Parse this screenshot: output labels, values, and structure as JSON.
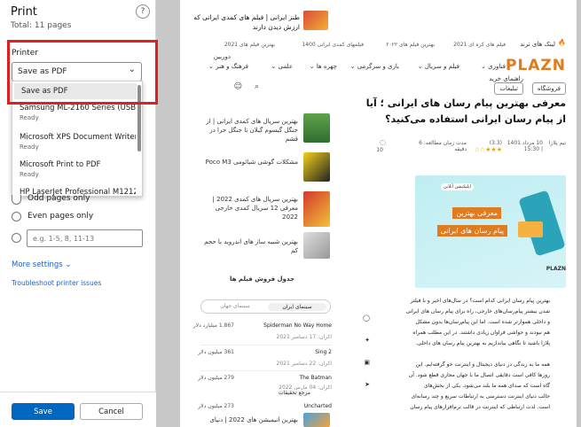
{
  "dialog": {
    "title": "Print",
    "total": "Total: 11 pages",
    "help": "?",
    "printer_label": "Printer",
    "selected_printer": "Save as PDF",
    "printers": [
      {
        "name": "Save as PDF",
        "status": ""
      },
      {
        "name": "Samsung ML-2160 Series (USB001)",
        "status": "Ready"
      },
      {
        "name": "Microsoft XPS Document Writer",
        "status": "Ready"
      },
      {
        "name": "Microsoft Print to PDF",
        "status": "Ready"
      },
      {
        "name": "HP LaserJet Professional M1212nf M",
        "status": ""
      }
    ],
    "odd_only": "Odd pages only",
    "even_only": "Even pages only",
    "range_placeholder": "e.g. 1-5, 8, 11-13",
    "more_settings": "More settings ⌄",
    "troubleshoot": "Troubleshoot printer issues",
    "save": "Save",
    "cancel": "Cancel"
  },
  "preview": {
    "promo": "طنز ایرانی | فیلم های کمدی ایرانی که ارزش دیدن دارند",
    "trend_label": "لینک های ترند",
    "trends": [
      "فیلم های کره ای 2021",
      "بهترین فیلم های ۲۰۲۲",
      "فیلمهای کمدی ایرانی 1400",
      "بهترین فیلم های 2021"
    ],
    "logo": "PLAZN",
    "nav": [
      "فناوری ⌄",
      "فیلم و سریال ⌄",
      "بازی و سرگرمی ⌄",
      "چهره ها ⌄",
      "علمی ⌄",
      "فرهنگ و هنر ⌄",
      "راهنمای خرید"
    ],
    "nav_extra": "دوربین",
    "shop": "فروشگاه",
    "ads": "تبلیغات",
    "article_title_1": "معرفی بهترین پیام رسان های ایرانی ؛ آیا",
    "article_title_2": "از پیام رسان ایرانی استفاده می‌کنید؟",
    "author": "تیم پلازا",
    "date": "10 مرداد 1401 | 15:30",
    "rating": "(3.3)",
    "read_time": "مدت زمان مطالعه: 6 دقیقه",
    "comments": "10",
    "banner_badge": "اپلیکیشن آنلاین",
    "banner_line1": "معرفی بهترین",
    "banner_line2": "پیام رسان های ایرانی",
    "banner_logo": "PLAZN",
    "body": [
      "بهترین پیام رسان ایرانی کدام است؟ در سال‌های اخیر و با فیلتر",
      "شدن بیشتر پیام‌رسان‌های خارجی، راه برای پیام رسان های ایرانی",
      "و داخلی هموارتر شده است. اما این پیام‌رسان‌ها بدون مشکل",
      "هم نبودند و حواشی فراوان زیادی داشتند. در این مطلب همراه",
      "پلازا باشید تا نگاهی بیاندازیم به بهترین پیام رسان های داخلی.",
      "",
      "همه ما به زندگی در دنیای دیجیتال و اینترنت خو گرفته‌ایم. این",
      "روزها کافی است دقایقی اتصال ما با جهان مجازی قطع شود. آن",
      "گاه است که صدای همه ما بلند می‌شود. یکی از بخش‌های",
      "جالب دنیای اینترنت دسترسی به ارتباطات سریع و چند رسانه‌ای",
      "است. لذت ارتباطی که اینترنت در قالب نرم‌افزارهای پیام رسان"
    ],
    "sidebar": [
      "بهترین سریال های کمدی ایرانی | از جنگل گیسوم گیلان تا جنگل حرا در قشم",
      "مشکلات گوشی شیائومی Poco M3",
      "بهترین سریال های کمدی 2022 | معرفی 12 سریال کمدی خارجی 2022",
      "بهترین شبیه ساز های اندروید با حجم کم"
    ],
    "sales_title": "جدول فروش فیلم ها",
    "tab_iran": "سینمای ایران",
    "tab_world": "سینمای جهان",
    "sales": [
      {
        "title": "Spiderman No Way Home",
        "amount": "1.867 میلیارد دلار",
        "date": "اکران: 17 دسامبر 2021"
      },
      {
        "title": "Sing 2",
        "amount": "361 میلیون دلار",
        "date": "اکران: 22 دسامبر 2021"
      },
      {
        "title": "The Batman",
        "amount": "279 میلیون دلار",
        "date": "اکران: 04 مارس 2022"
      },
      {
        "title": "Uncharted",
        "amount": "273 میلیون دلار",
        "date": ""
      }
    ],
    "bottom_article": "بهترین انیمیشن های 2022 | دنیای",
    "bottom_overlay": "مرجع تحقیقات"
  },
  "colors": {
    "accent": "#0067c0",
    "highlight": "#e02020",
    "link": "#1a60c8",
    "brand": "#e07b20"
  }
}
